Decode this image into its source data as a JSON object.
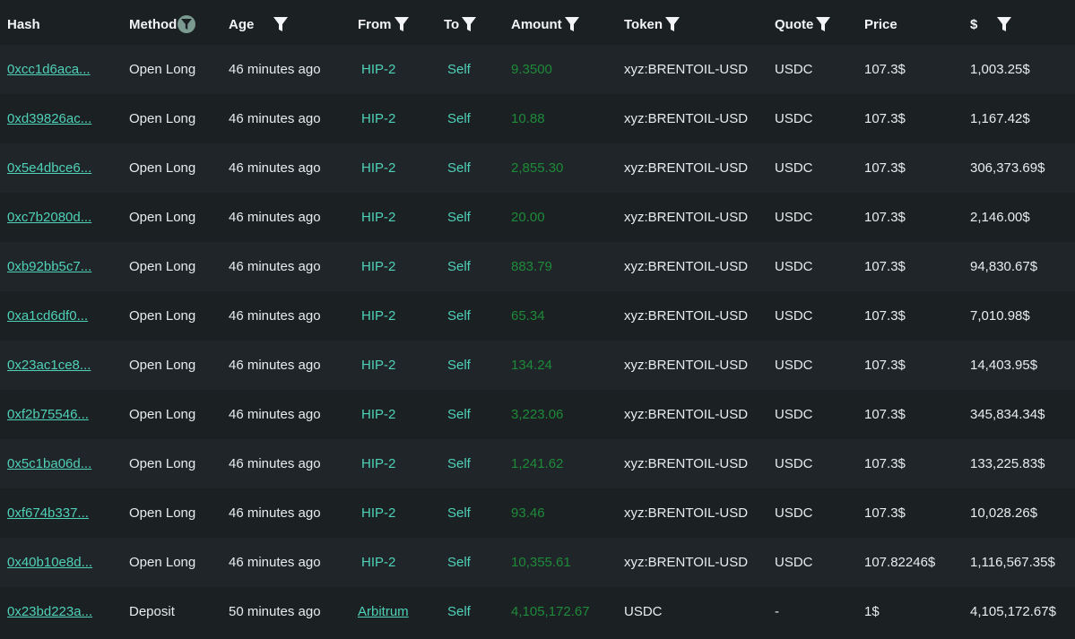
{
  "columns": {
    "hash": "Hash",
    "method": "Method",
    "age": "Age",
    "from": "From",
    "to": "To",
    "amount": "Amount",
    "token": "Token",
    "quote": "Quote",
    "price": "Price",
    "usd": "$"
  },
  "colors": {
    "background": "#1b2023",
    "link": "#4fd1b8",
    "amount": "#1f8a3a",
    "active_filter": "#7b9a90"
  },
  "rows": [
    {
      "hash": "0xcc1d6aca...",
      "method": "Open Long",
      "age": "46 minutes ago",
      "from": "HIP-2",
      "to": "Self",
      "amount": "9.3500",
      "token": "xyz:BRENTOIL-USD",
      "quote": "USDC",
      "price": "107.3$",
      "usd": "1,003.25$"
    },
    {
      "hash": "0xd39826ac...",
      "method": "Open Long",
      "age": "46 minutes ago",
      "from": "HIP-2",
      "to": "Self",
      "amount": "10.88",
      "token": "xyz:BRENTOIL-USD",
      "quote": "USDC",
      "price": "107.3$",
      "usd": "1,167.42$"
    },
    {
      "hash": "0x5e4dbce6...",
      "method": "Open Long",
      "age": "46 minutes ago",
      "from": "HIP-2",
      "to": "Self",
      "amount": "2,855.30",
      "token": "xyz:BRENTOIL-USD",
      "quote": "USDC",
      "price": "107.3$",
      "usd": "306,373.69$"
    },
    {
      "hash": "0xc7b2080d...",
      "method": "Open Long",
      "age": "46 minutes ago",
      "from": "HIP-2",
      "to": "Self",
      "amount": "20.00",
      "token": "xyz:BRENTOIL-USD",
      "quote": "USDC",
      "price": "107.3$",
      "usd": "2,146.00$"
    },
    {
      "hash": "0xb92bb5c7...",
      "method": "Open Long",
      "age": "46 minutes ago",
      "from": "HIP-2",
      "to": "Self",
      "amount": "883.79",
      "token": "xyz:BRENTOIL-USD",
      "quote": "USDC",
      "price": "107.3$",
      "usd": "94,830.67$"
    },
    {
      "hash": "0xa1cd6df0...",
      "method": "Open Long",
      "age": "46 minutes ago",
      "from": "HIP-2",
      "to": "Self",
      "amount": "65.34",
      "token": "xyz:BRENTOIL-USD",
      "quote": "USDC",
      "price": "107.3$",
      "usd": "7,010.98$"
    },
    {
      "hash": "0x23ac1ce8...",
      "method": "Open Long",
      "age": "46 minutes ago",
      "from": "HIP-2",
      "to": "Self",
      "amount": "134.24",
      "token": "xyz:BRENTOIL-USD",
      "quote": "USDC",
      "price": "107.3$",
      "usd": "14,403.95$"
    },
    {
      "hash": "0xf2b75546...",
      "method": "Open Long",
      "age": "46 minutes ago",
      "from": "HIP-2",
      "to": "Self",
      "amount": "3,223.06",
      "token": "xyz:BRENTOIL-USD",
      "quote": "USDC",
      "price": "107.3$",
      "usd": "345,834.34$"
    },
    {
      "hash": "0x5c1ba06d...",
      "method": "Open Long",
      "age": "46 minutes ago",
      "from": "HIP-2",
      "to": "Self",
      "amount": "1,241.62",
      "token": "xyz:BRENTOIL-USD",
      "quote": "USDC",
      "price": "107.3$",
      "usd": "133,225.83$"
    },
    {
      "hash": "0xf674b337...",
      "method": "Open Long",
      "age": "46 minutes ago",
      "from": "HIP-2",
      "to": "Self",
      "amount": "93.46",
      "token": "xyz:BRENTOIL-USD",
      "quote": "USDC",
      "price": "107.3$",
      "usd": "10,028.26$"
    },
    {
      "hash": "0x40b10e8d...",
      "method": "Open Long",
      "age": "46 minutes ago",
      "from": "HIP-2",
      "to": "Self",
      "amount": "10,355.61",
      "token": "xyz:BRENTOIL-USD",
      "quote": "USDC",
      "price": "107.82246$",
      "usd": "1,116,567.35$"
    },
    {
      "hash": "0x23bd223a...",
      "method": "Deposit",
      "age": "50 minutes ago",
      "from": "Arbitrum",
      "to": "Self",
      "amount": "4,105,172.67",
      "token": "USDC",
      "quote": "-",
      "price": "1$",
      "usd": "4,105,172.67$"
    }
  ]
}
